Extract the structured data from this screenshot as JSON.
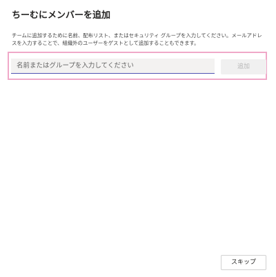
{
  "dialog": {
    "title": "ちーむにメンバーを追加",
    "description": "チームに追加するために名前、配布リスト、またはセキュリティ グループを入力してください。メールアドレスを入力することで、組織外のユーザーをゲストとして追加することもできます。"
  },
  "member_search": {
    "placeholder": "名前またはグループを入力してください",
    "value": ""
  },
  "buttons": {
    "add_label": "追加",
    "add_disabled": true,
    "skip_label": "スキップ"
  },
  "colors": {
    "highlight_frame": "#f0a8c8",
    "input_underline": "#4f52b2",
    "input_background": "#f3f2f1",
    "disabled_button_background": "#f0f0f0"
  }
}
